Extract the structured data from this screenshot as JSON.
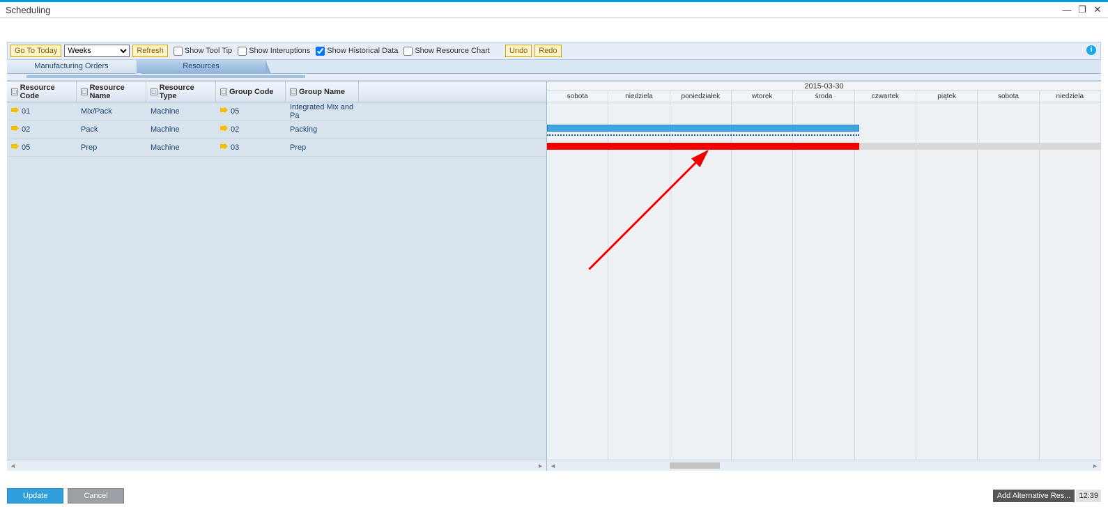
{
  "window": {
    "title": "Scheduling"
  },
  "toolbar": {
    "go_today": "Go To Today",
    "period_selected": "Weeks",
    "refresh": "Refresh",
    "show_tooltip": "Show Tool Tip",
    "show_interruptions": "Show Interuptions",
    "show_historical": "Show Historical Data",
    "show_resource_chart": "Show Resource Chart",
    "undo": "Undo",
    "redo": "Redo"
  },
  "tabs": {
    "manufacturing_orders": "Manufacturing Orders",
    "resources": "Resources"
  },
  "columns": {
    "resource_code": "Resource Code",
    "resource_name": "Resource Name",
    "resource_type": "Resource Type",
    "group_code": "Group Code",
    "group_name": "Group Name"
  },
  "rows": [
    {
      "code": "01",
      "name": "Mix/Pack",
      "type": "Machine",
      "gcode": "05",
      "gname": "Integrated Mix and Pa"
    },
    {
      "code": "02",
      "name": "Pack",
      "type": "Machine",
      "gcode": "02",
      "gname": "Packing"
    },
    {
      "code": "05",
      "name": "Prep",
      "type": "Machine",
      "gcode": "03",
      "gname": "Prep"
    }
  ],
  "calendar": {
    "header_date": "2015-03-30",
    "days": [
      "sobota",
      "niedziela",
      "poniedziałek",
      "wtorek",
      "środa",
      "czwartek",
      "piątek",
      "sobota",
      "niedziela"
    ]
  },
  "footer": {
    "update": "Update",
    "cancel": "Cancel",
    "status": "Add Alternative Res...",
    "time": "12:39"
  }
}
